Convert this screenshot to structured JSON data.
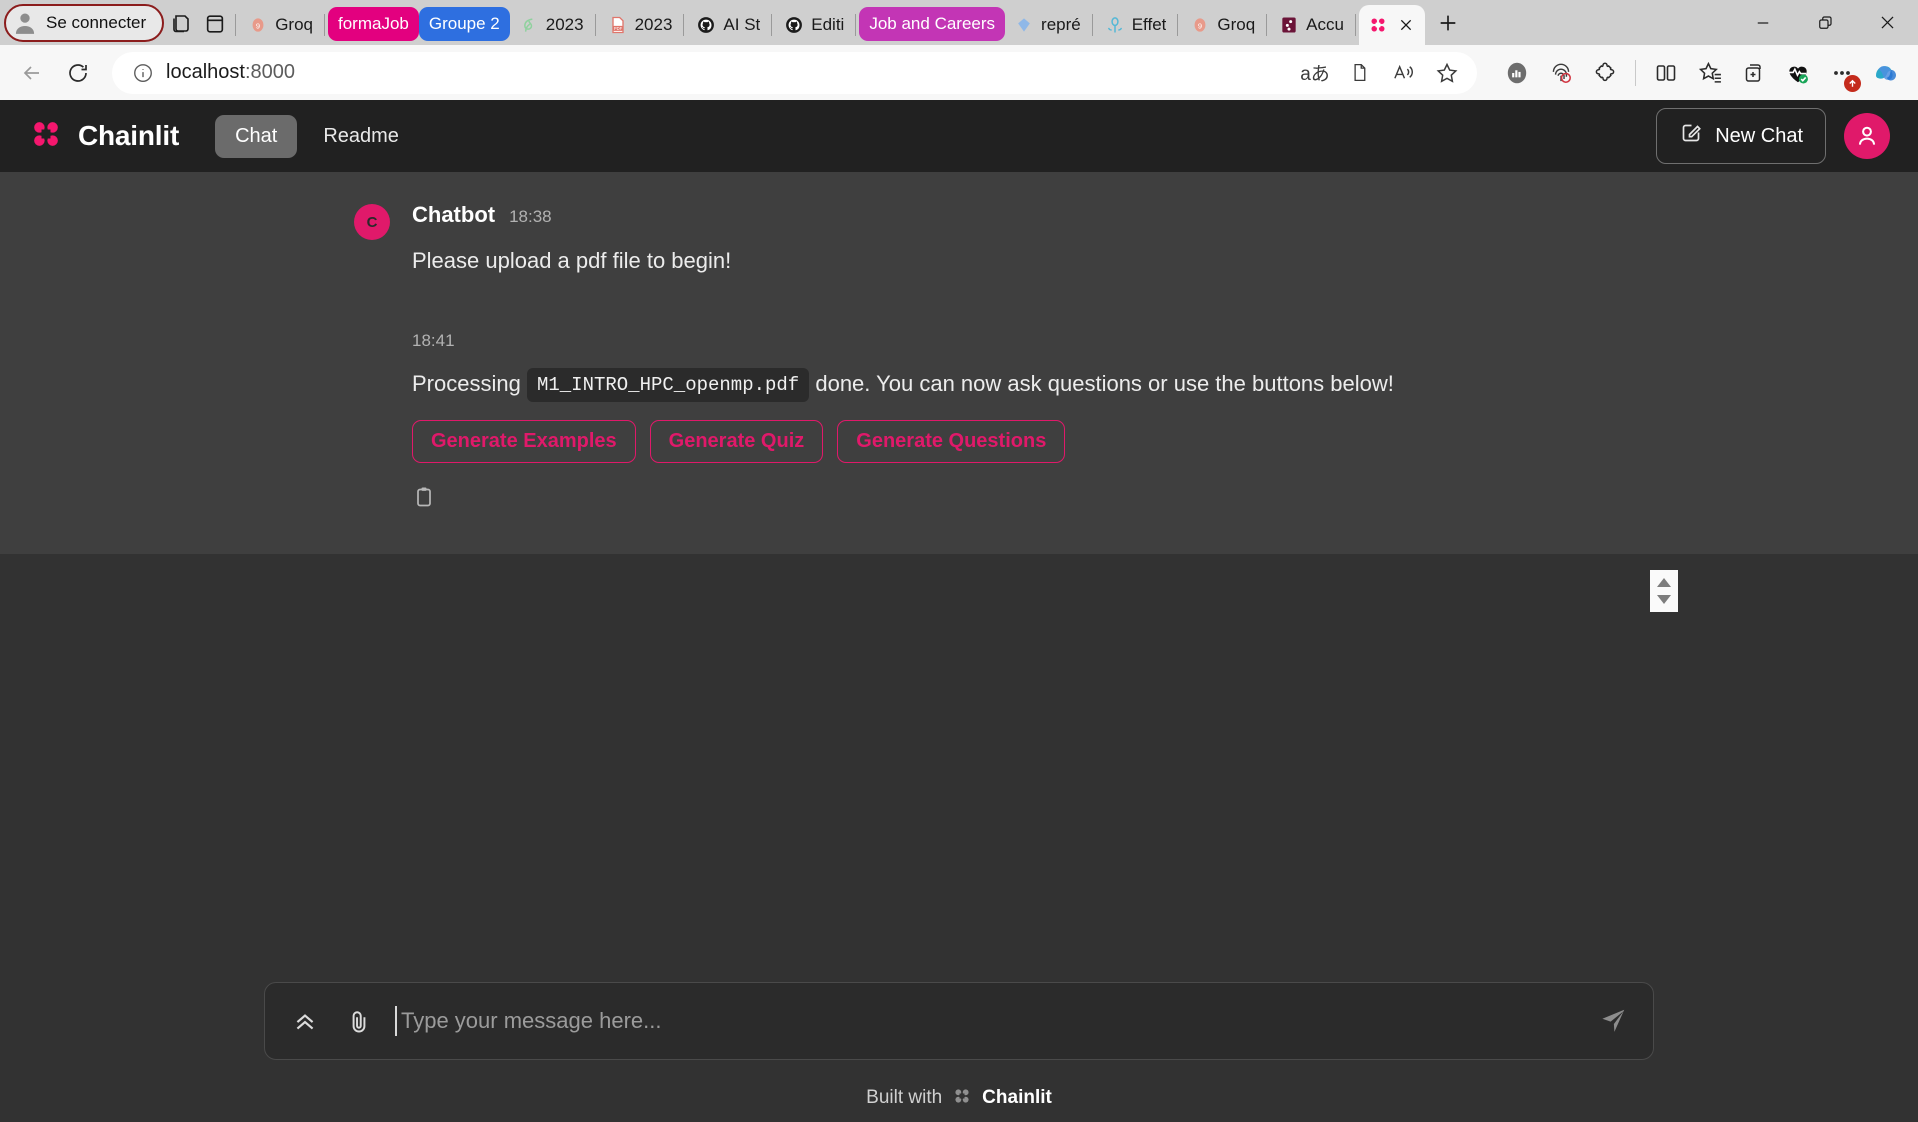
{
  "browser": {
    "signin_label": "Se connecter",
    "tabs": [
      {
        "label": "Groq",
        "favicon": "groq-icon",
        "style": "plain",
        "accent": "#e89a8a"
      },
      {
        "label": "formaJob",
        "favicon": "none",
        "style": "pill",
        "accent": "#e3007f"
      },
      {
        "label": "Groupe 2",
        "favicon": "none",
        "style": "pill",
        "accent": "#2e6fe0"
      },
      {
        "label": "2023",
        "favicon": "leaf-icon",
        "style": "plain",
        "accent": "#8fd19e"
      },
      {
        "label": "2023",
        "favicon": "pdf-icon",
        "style": "plain",
        "accent": "#e0756b"
      },
      {
        "label": "AI St",
        "favicon": "github-icon",
        "style": "plain",
        "accent": "#1b1b1b"
      },
      {
        "label": "Editi",
        "favicon": "github-icon",
        "style": "plain",
        "accent": "#1b1b1b"
      },
      {
        "label": "Job and Careers",
        "favicon": "none",
        "style": "pill",
        "accent": "#c335b5"
      },
      {
        "label": "repré",
        "favicon": "diamond-icon",
        "style": "plain",
        "accent": "#8fb8e8"
      },
      {
        "label": "Effet",
        "favicon": "flower-icon",
        "style": "plain",
        "accent": "#55b8d6"
      },
      {
        "label": "Groq",
        "favicon": "groq-icon",
        "style": "plain",
        "accent": "#e89a8a"
      },
      {
        "label": "Accu",
        "favicon": "app-icon",
        "style": "plain",
        "accent": "#6b1438"
      }
    ],
    "active_tab": {
      "label": "",
      "favicon": "chainlit-icon"
    },
    "new_tab_label": "+",
    "window_controls": [
      "minimize",
      "restore",
      "close"
    ],
    "address": {
      "host": "localhost",
      "port": ":8000",
      "info_icon": "info-icon"
    },
    "omnibox_icons": [
      "translate-icon",
      "reading-view-icon",
      "read-aloud-icon",
      "favorite-star-icon"
    ],
    "toolbar_icons": [
      "performance-icon",
      "fingerprint-icon",
      "extensions-icon",
      "split-screen-icon",
      "favorites-icon",
      "collections-icon",
      "drop-health-icon",
      "settings-more-icon",
      "copilot-icon"
    ],
    "settings_badge": "1"
  },
  "app": {
    "brand": "Chainlit",
    "brand_logo": "chainlit-logo-icon",
    "nav_tabs": [
      {
        "label": "Chat",
        "selected": true
      },
      {
        "label": "Readme",
        "selected": false
      }
    ],
    "new_chat_label": "New Chat",
    "new_chat_icon": "edit-square-icon",
    "avatar_icon": "user-icon"
  },
  "conversation": {
    "messages": [
      {
        "avatar_initial": "C",
        "author": "Chatbot",
        "time": "18:38",
        "text": "Please upload a pdf file to begin!"
      },
      {
        "time": "18:41",
        "text_before": "Processing",
        "code_chip": "M1_INTRO_HPC_openmp.pdf",
        "text_after": "done. You can now ask questions or use the buttons below!",
        "actions": [
          {
            "label": "Generate Examples"
          },
          {
            "label": "Generate Quiz"
          },
          {
            "label": "Generate Questions"
          }
        ],
        "copy_icon": "clipboard-copy-icon"
      }
    ],
    "scroll_stepper": {
      "up": "triangle-up-icon",
      "down": "triangle-down-icon"
    }
  },
  "composer": {
    "expand_icon": "chevrons-up-icon",
    "attach_icon": "paperclip-icon",
    "placeholder": "Type your message here...",
    "value": "",
    "send_icon": "send-plane-icon"
  },
  "footer": {
    "built_with": "Built with",
    "brand": "Chainlit",
    "logo": "chainlit-logo-gray-icon"
  },
  "colors": {
    "accent_pink": "#e0196a",
    "app_bg": "#212121",
    "convo_bg": "#3f3f3f",
    "panel_bg": "#323232"
  }
}
